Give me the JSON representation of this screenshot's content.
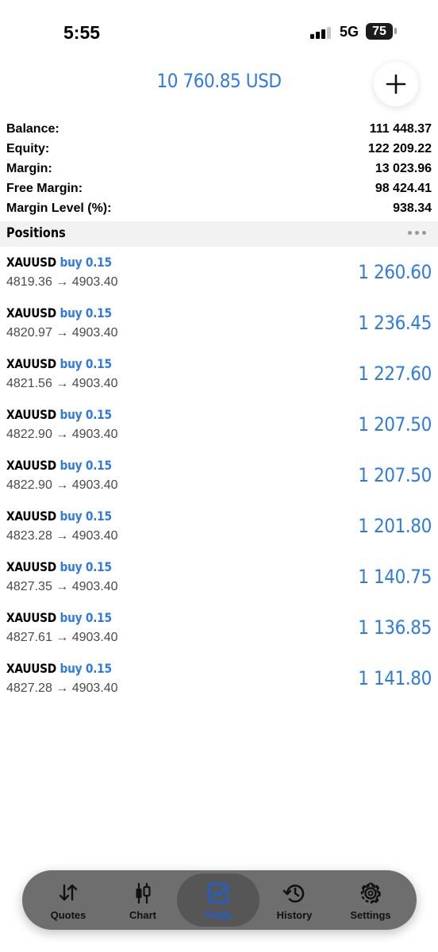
{
  "status_bar": {
    "time": "5:55",
    "network": "5G",
    "battery": "75"
  },
  "header": {
    "amount": "10 760.85 USD"
  },
  "summary": [
    {
      "label": "Balance:",
      "value": "111 448.37"
    },
    {
      "label": "Equity:",
      "value": "122 209.22"
    },
    {
      "label": "Margin:",
      "value": "13 023.96"
    },
    {
      "label": "Free Margin:",
      "value": "98 424.41"
    },
    {
      "label": "Margin Level (%):",
      "value": "938.34"
    }
  ],
  "positions": {
    "title": "Positions",
    "items": [
      {
        "symbol": "XAUUSD",
        "side": "buy 0.15",
        "prices": "4819.36 → 4903.40",
        "profit": "1 260.60"
      },
      {
        "symbol": "XAUUSD",
        "side": "buy 0.15",
        "prices": "4820.97 → 4903.40",
        "profit": "1 236.45"
      },
      {
        "symbol": "XAUUSD",
        "side": "buy 0.15",
        "prices": "4821.56 → 4903.40",
        "profit": "1 227.60"
      },
      {
        "symbol": "XAUUSD",
        "side": "buy 0.15",
        "prices": "4822.90 → 4903.40",
        "profit": "1 207.50"
      },
      {
        "symbol": "XAUUSD",
        "side": "buy 0.15",
        "prices": "4822.90 → 4903.40",
        "profit": "1 207.50"
      },
      {
        "symbol": "XAUUSD",
        "side": "buy 0.15",
        "prices": "4823.28 → 4903.40",
        "profit": "1 201.80"
      },
      {
        "symbol": "XAUUSD",
        "side": "buy 0.15",
        "prices": "4827.35 → 4903.40",
        "profit": "1 140.75"
      },
      {
        "symbol": "XAUUSD",
        "side": "buy 0.15",
        "prices": "4827.61 → 4903.40",
        "profit": "1 136.85"
      },
      {
        "symbol": "XAUUSD",
        "side": "buy 0.15",
        "prices": "4827.28 → 4903.40",
        "profit": "1 141.80"
      }
    ]
  },
  "tabs": [
    {
      "label": "Quotes",
      "icon": "quotes-icon"
    },
    {
      "label": "Chart",
      "icon": "chart-icon"
    },
    {
      "label": "Trade",
      "icon": "trade-icon",
      "active": true
    },
    {
      "label": "History",
      "icon": "history-icon"
    },
    {
      "label": "Settings",
      "icon": "settings-icon"
    }
  ],
  "colors": {
    "accent": "#2f7be0",
    "active_tab": "#1f5fd6",
    "tab_bar": "#6e6e6e"
  }
}
